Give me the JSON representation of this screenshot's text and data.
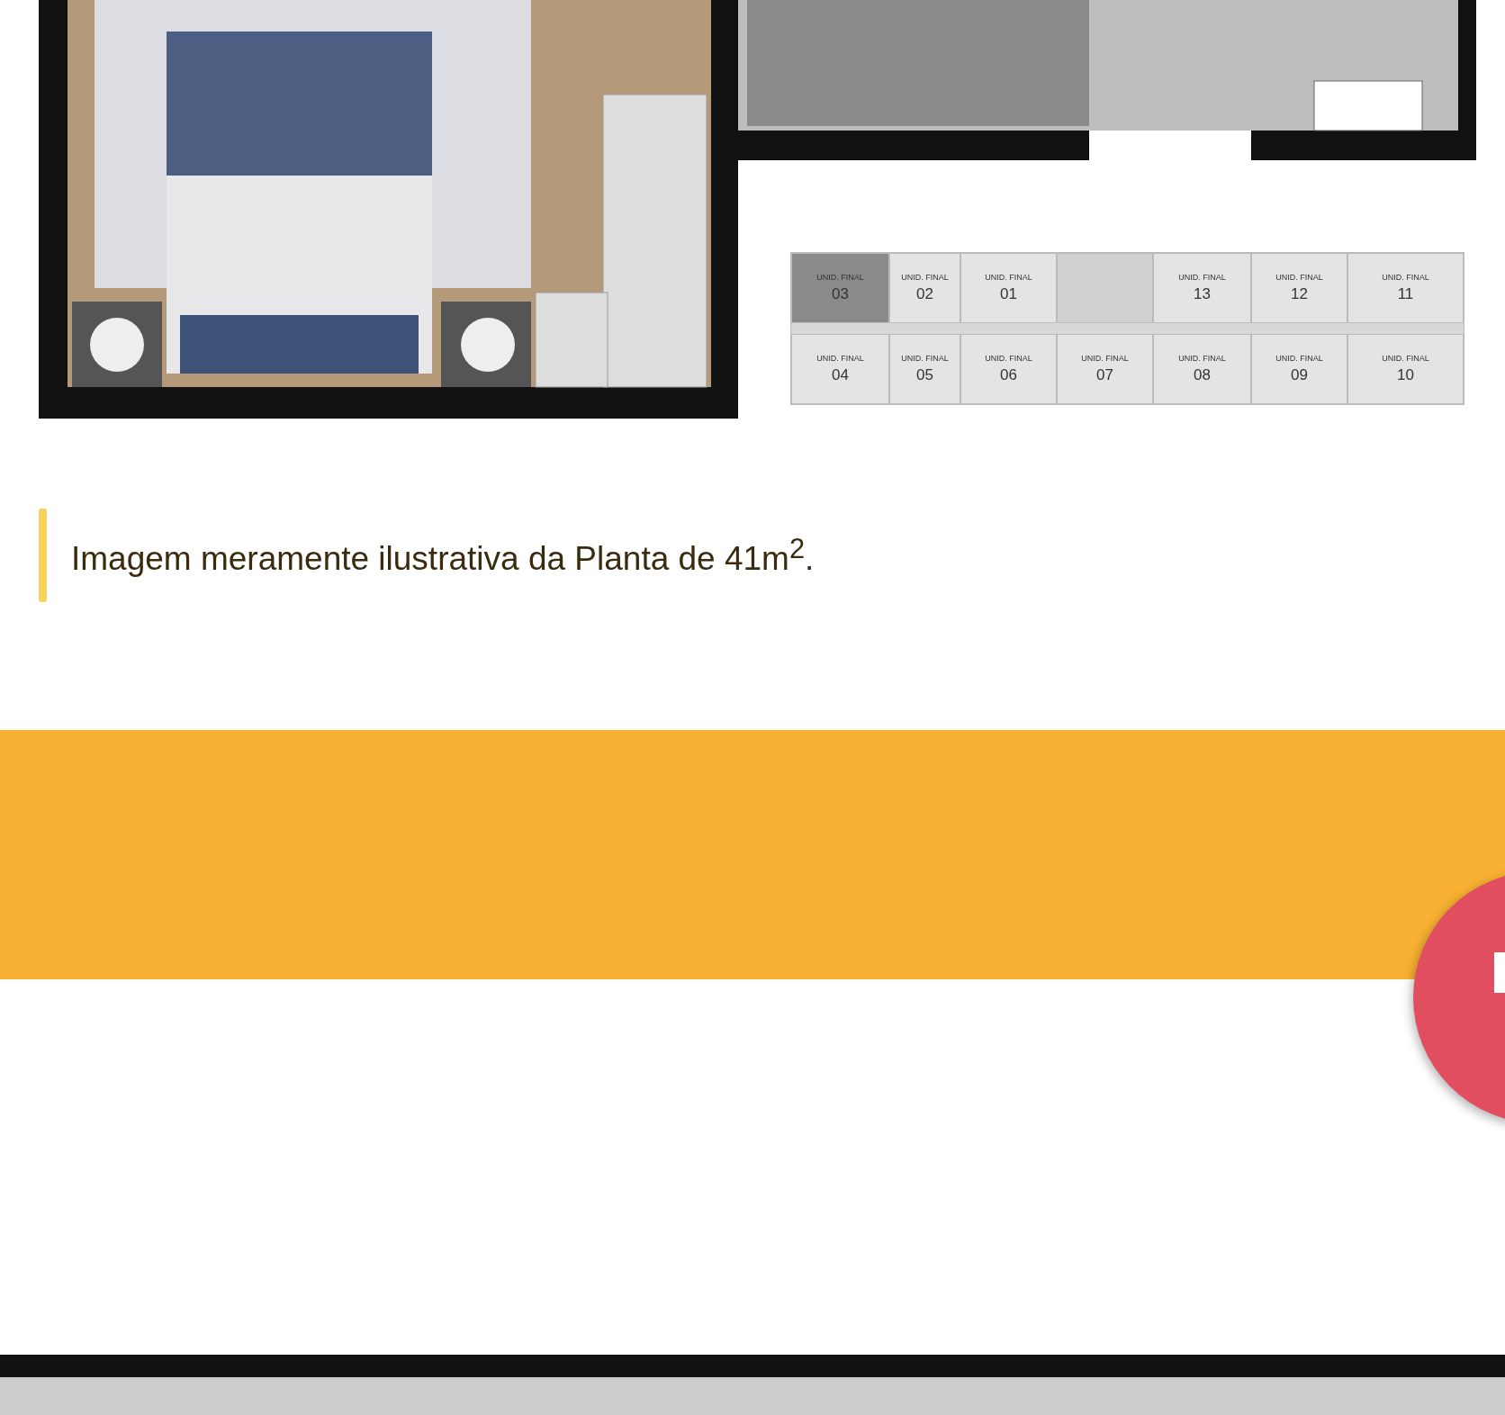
{
  "unit_key": {
    "rows": [
      [
        {
          "kind": "unit",
          "label": "UNID. FINAL",
          "number": "03",
          "selected": true
        },
        {
          "kind": "unit",
          "label": "UNID. FINAL",
          "number": "02",
          "selected": false
        },
        {
          "kind": "unit",
          "label": "UNID. FINAL",
          "number": "01",
          "selected": false
        },
        {
          "kind": "core"
        },
        {
          "kind": "unit",
          "label": "UNID. FINAL",
          "number": "13",
          "selected": false
        },
        {
          "kind": "unit",
          "label": "UNID. FINAL",
          "number": "12",
          "selected": false
        },
        {
          "kind": "unit",
          "label": "UNID. FINAL",
          "number": "11",
          "selected": false
        }
      ],
      [
        {
          "kind": "unit",
          "label": "UNID. FINAL",
          "number": "04",
          "selected": false
        },
        {
          "kind": "unit",
          "label": "UNID. FINAL",
          "number": "05",
          "selected": false
        },
        {
          "kind": "unit",
          "label": "UNID. FINAL",
          "number": "06",
          "selected": false
        },
        {
          "kind": "unit",
          "label": "UNID. FINAL",
          "number": "07",
          "selected": false
        },
        {
          "kind": "unit",
          "label": "UNID. FINAL",
          "number": "08",
          "selected": false
        },
        {
          "kind": "unit",
          "label": "UNID. FINAL",
          "number": "09",
          "selected": false
        },
        {
          "kind": "unit",
          "label": "UNID. FINAL",
          "number": "10",
          "selected": false
        }
      ]
    ]
  },
  "caption": "Imagem meramente ilustrativa da Planta de 41m$^{2}$."
}
